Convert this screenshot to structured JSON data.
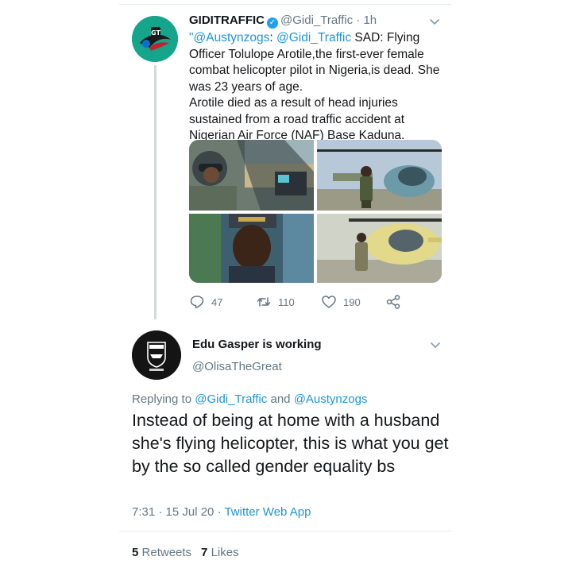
{
  "quoted_tweet": {
    "display_name": "GIDITRAFFIC",
    "handle": "@Gidi_Traffic",
    "separator": "·",
    "time": "1h",
    "avatar_text": "GT",
    "text": {
      "mention_1": "\"@Austynzogs",
      "colon_1": ": ",
      "mention_2": "@Gidi_Traffic",
      "line_1_rest": " SAD: Flying Officer Tolulope Arotile,the first-ever female combat helicopter pilot in Nigeria,is dead. She was  23 years of age.",
      "line_2": "Arotile died as a result of head injuries sustained from a road traffic accident at Nigerian Air Force (NAF) Base Kaduna."
    },
    "actions": {
      "replies": "47",
      "retweets": "110",
      "likes": "190"
    }
  },
  "reply_tweet": {
    "display_name": "Edu Gasper is working",
    "handle": "@OlisaTheGreat",
    "replying_prefix": "Replying to ",
    "replying_mention_1": "@Gidi_Traffic",
    "replying_and": " and ",
    "replying_mention_2": "@Austynzogs",
    "text": "Instead of being at home with a husband she's flying helicopter, this is what you get by the so called gender equality bs",
    "time": "7:31 · 15 Jul 20 · ",
    "source": "Twitter Web App",
    "retweets_count": "5",
    "retweets_label": "Retweets",
    "likes_count": "7",
    "likes_label": "Likes"
  },
  "colors": {
    "accent": "#1b95e0",
    "verified": "#1da1f2",
    "secondary_text": "#657786"
  },
  "icons": [
    "verified-badge-icon",
    "chevron-down-icon",
    "reply-icon",
    "retweet-icon",
    "like-icon",
    "share-icon"
  ]
}
